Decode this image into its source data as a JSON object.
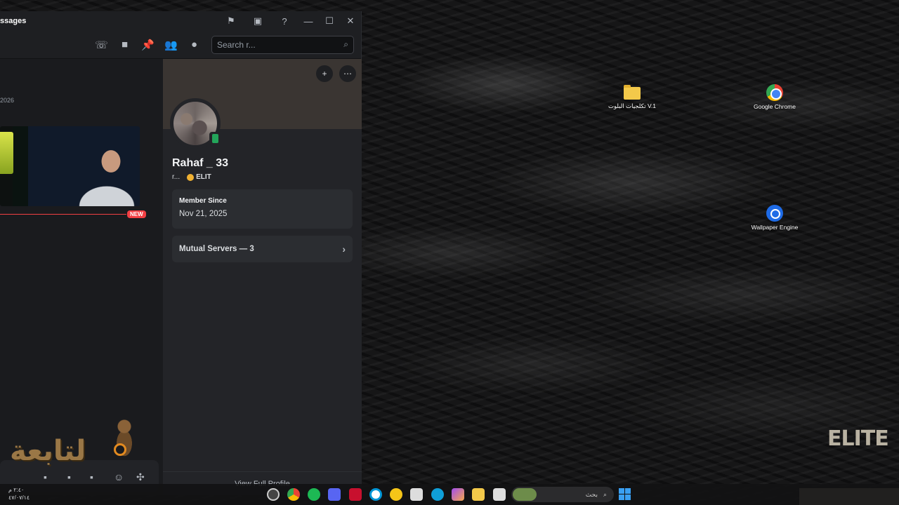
{
  "window": {
    "title": "ssages",
    "title_icons": [
      "inbox-flag-icon",
      "screen-share-icon",
      "help-icon"
    ],
    "controls": {
      "minimize": "—",
      "maximize": "☐",
      "close": "✕"
    }
  },
  "toolbar": {
    "icons": [
      "voice-call-icon",
      "video-call-icon",
      "pinned-icon",
      "add-member-icon",
      "user-profile-icon"
    ],
    "search_placeholder": "Search r..."
  },
  "chat": {
    "date_fragment": "2026",
    "new_badge": "NEW"
  },
  "profile": {
    "display_name": "Rahaf _ 33",
    "username": "r...",
    "tag": "ELIT",
    "member_since_label": "Member Since",
    "member_since_value": "Nov 21, 2025",
    "mutual_servers": "Mutual Servers — 3",
    "view_full_profile": "View Full Profile"
  },
  "overlay": {
    "arabic_logo": "لتابعة",
    "elite_logo": "ELITE"
  },
  "desktop": {
    "icons": [
      {
        "label": "تكلجيات البلوت V.1",
        "kind": "folder"
      },
      {
        "label": "Google Chrome",
        "kind": "chrome"
      },
      {
        "label": "Wallpaper Engine",
        "kind": "wallpaper-engine"
      }
    ]
  },
  "taskbar": {
    "clock_time": "٢:٤٠ م",
    "clock_date": "٤٧/٠٧/١٤",
    "search_text": "بحث",
    "accent": "#3aa0f3"
  }
}
